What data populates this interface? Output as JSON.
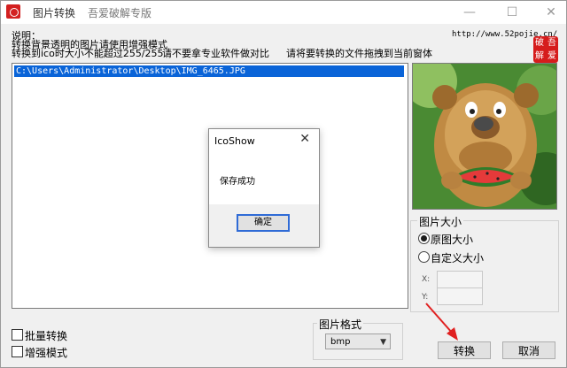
{
  "window": {
    "title": "图片转换",
    "subtitle": "吾爱破解专版",
    "min": "—",
    "max": "☐",
    "close": "✕"
  },
  "description": {
    "heading": "说明：",
    "line1": "转换背景透明的图片请使用增强模式",
    "line2_a": "转换到ico时大小不能超过255/255",
    "line2_b": "请不要拿专业软件做对比",
    "line2_c": "请将要转换的文件拖拽到当前窗体",
    "url": "http://www.52pojie.cn/"
  },
  "logo": {
    "c1": "吾",
    "c2": "爱",
    "c3": "破",
    "c4": "解"
  },
  "file_list": {
    "items": [
      "C:\\Users\\Administrator\\Desktop\\IMG_6465.JPG"
    ]
  },
  "size_group": {
    "title": "图片大小",
    "original": "原图大小",
    "custom": "自定义大小",
    "x_label": "X:",
    "y_label": "Y:",
    "selected": "original"
  },
  "options": {
    "batch": "批量转换",
    "enhanced": "增强模式"
  },
  "format_group": {
    "title": "图片格式",
    "selected": "bmp"
  },
  "buttons": {
    "convert": "转换",
    "cancel": "取消"
  },
  "dialog": {
    "title": "IcoShow",
    "message": "保存成功",
    "ok": "确定",
    "close": "✕"
  },
  "colors": {
    "selection": "#0a64d8",
    "logo_red": "#d61c1c",
    "arrow_red": "#e02020"
  },
  "icons": {
    "app": "app-logo-icon",
    "dropdown": "chevron-down-icon",
    "close": "close-icon"
  }
}
